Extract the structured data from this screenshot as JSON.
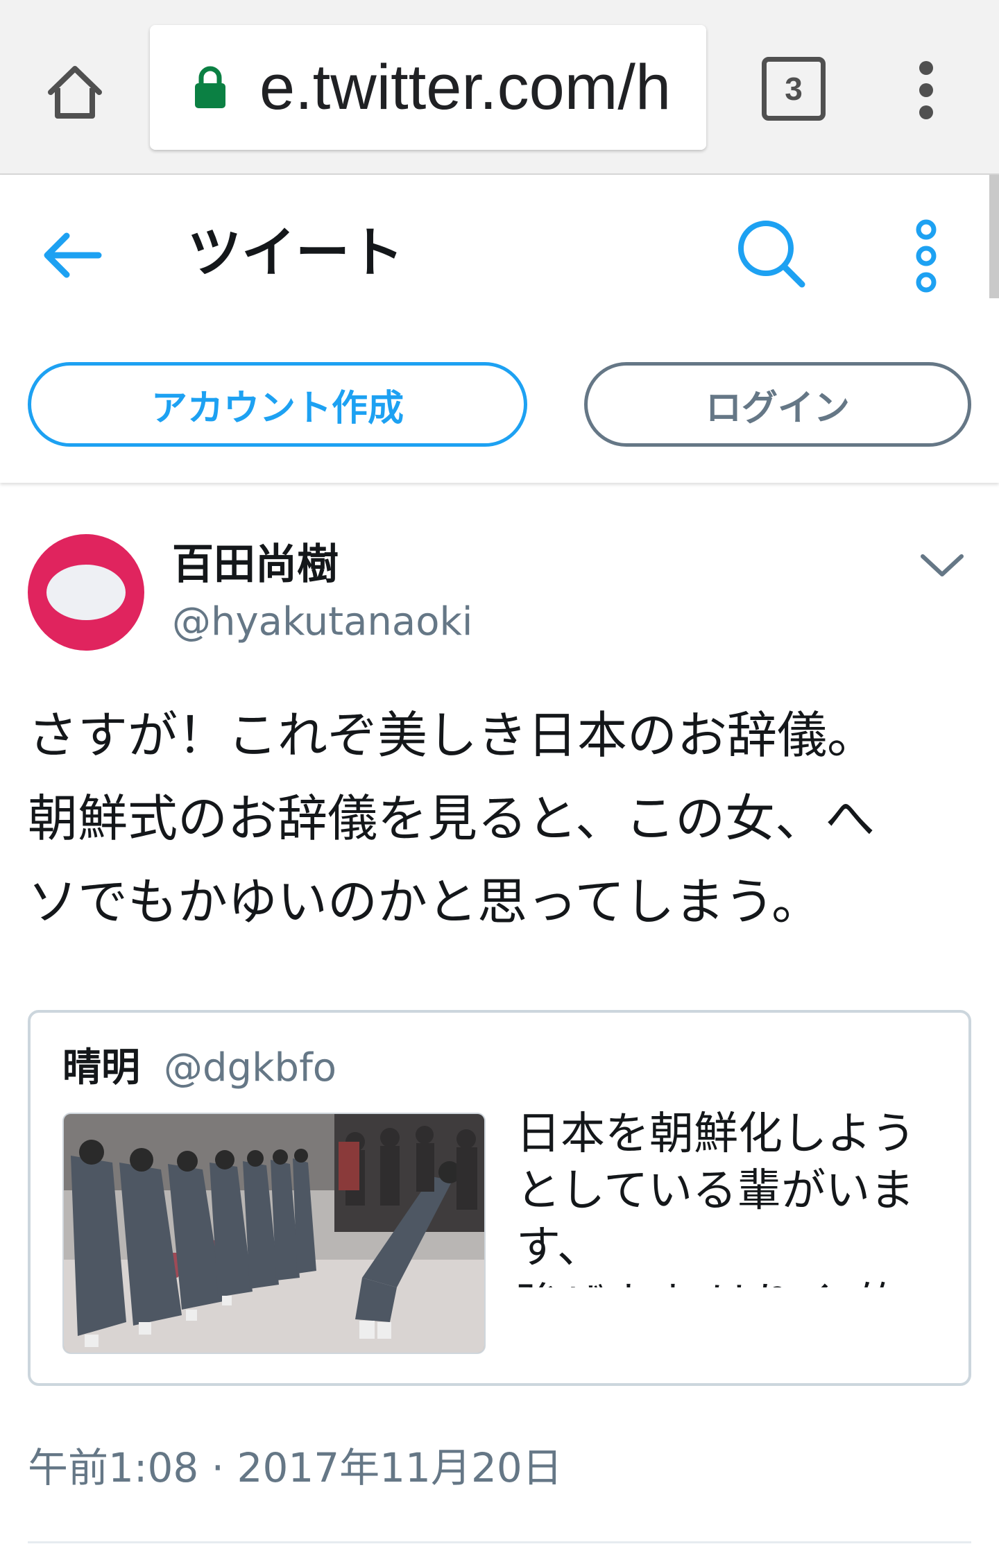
{
  "browser": {
    "url": "e.twitter.com/h",
    "tab_count": "3",
    "icons": {
      "home": "home-icon",
      "lock": "lock-icon",
      "menu": "vertical-dots-icon"
    }
  },
  "header": {
    "title": "ツイート",
    "signup_label": "アカウント作成",
    "login_label": "ログイン",
    "icons": {
      "back": "arrow-left-icon",
      "search": "search-icon",
      "more": "vertical-dots-icon"
    }
  },
  "tweet": {
    "author_name": "百田尚樹",
    "author_handle": "@hyakutanaoki",
    "text": "さすが！これぞ美しき日本のお辞儀。\n朝鮮式のお辞儀を見ると、この女、へ\nソでもかゆいのかと思ってしまう。",
    "timestamp": "午前1:08 · 2017年11月20日",
    "quote": {
      "author_name": "晴明",
      "author_handle": "@dgkbfo",
      "text": "日本を朝鮮化しよう\nとしている輩がいま\nす、\n強ぜまま はりく 的性"
    }
  },
  "colors": {
    "twitter_blue": "#1da1f2",
    "secondary_gray": "#657786",
    "avatar_red": "#e0245e",
    "card_border": "#ccd6dd"
  }
}
